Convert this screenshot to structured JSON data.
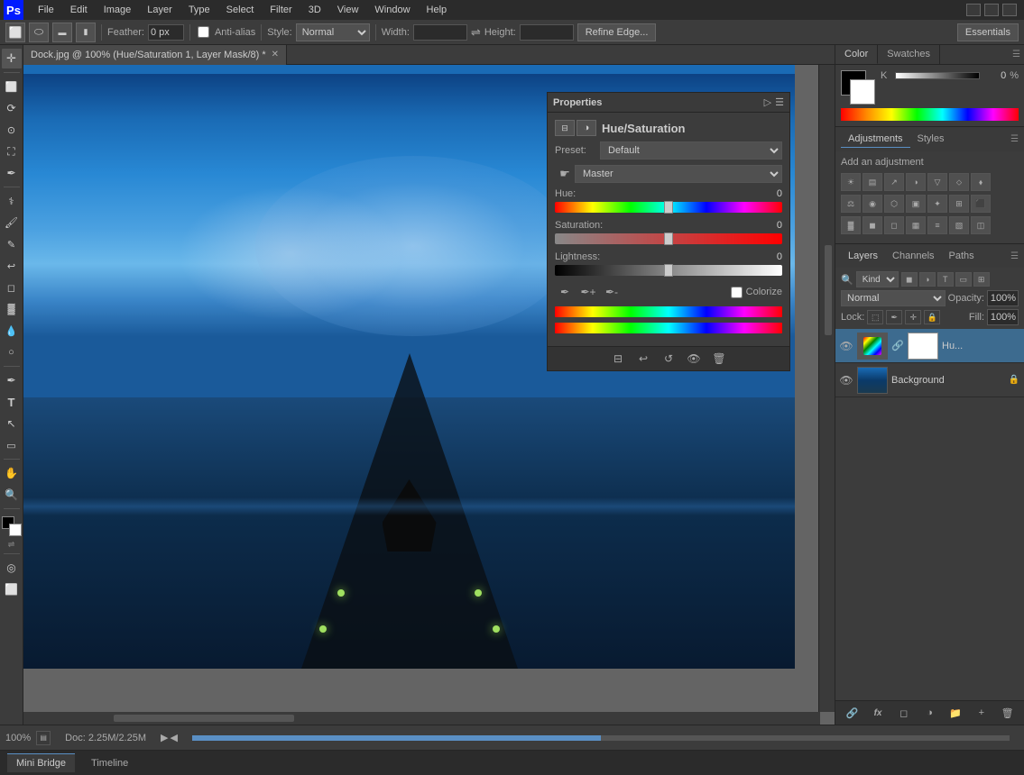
{
  "app": {
    "logo": "Ps",
    "workspace": "Essentials"
  },
  "menu": {
    "items": [
      "File",
      "Edit",
      "Image",
      "Layer",
      "Type",
      "Select",
      "Filter",
      "3D",
      "View",
      "Window",
      "Help"
    ]
  },
  "toolbar": {
    "feather_label": "Feather:",
    "feather_value": "0 px",
    "anti_alias_label": "Anti-alias",
    "style_label": "Style:",
    "style_value": "Normal",
    "width_label": "Width:",
    "height_label": "Height:",
    "refine_edge": "Refine Edge...",
    "essentials": "Essentials"
  },
  "canvas": {
    "tab_title": "Dock.jpg @ 100% (Hue/Saturation 1, Layer Mask/8) *"
  },
  "properties_panel": {
    "title": "Properties",
    "adjustment_title": "Hue/Saturation",
    "preset_label": "Preset:",
    "preset_value": "Default",
    "channel_value": "Master",
    "hue_label": "Hue:",
    "hue_value": "0",
    "saturation_label": "Saturation:",
    "saturation_value": "0",
    "lightness_label": "Lightness:",
    "lightness_value": "0",
    "colorize_label": "Colorize"
  },
  "color_panel": {
    "tab_color": "Color",
    "tab_swatches": "Swatches",
    "k_label": "K",
    "k_value": "0",
    "k_percent": "%"
  },
  "adjustments_panel": {
    "title": "Add an adjustment",
    "tab_adjustments": "Adjustments",
    "tab_styles": "Styles",
    "icons": [
      "☀",
      "▤",
      "◑",
      "◆",
      "▽",
      "⬦",
      "◧",
      "⚖",
      "☯",
      "⬡",
      "▣",
      "✦",
      "📷",
      "🔧",
      "◻",
      "▦",
      "≡",
      "🔲",
      "▣",
      "◼",
      "🔲"
    ]
  },
  "layers_panel": {
    "tab_layers": "Layers",
    "tab_channels": "Channels",
    "tab_paths": "Paths",
    "kind_label": "Kind",
    "blend_mode": "Normal",
    "opacity_label": "Opacity:",
    "opacity_value": "100%",
    "fill_label": "Fill:",
    "fill_value": "100%",
    "lock_label": "Lock:",
    "layers": [
      {
        "name": "Hu...",
        "type": "adjustment",
        "visible": true
      },
      {
        "name": "Background",
        "type": "image",
        "visible": true,
        "locked": true
      }
    ]
  },
  "bottom_bar": {
    "zoom": "100%",
    "doc_info": "Doc: 2.25M/2.25M"
  },
  "status_bar": {
    "tabs": [
      "Mini Bridge",
      "Timeline"
    ]
  }
}
